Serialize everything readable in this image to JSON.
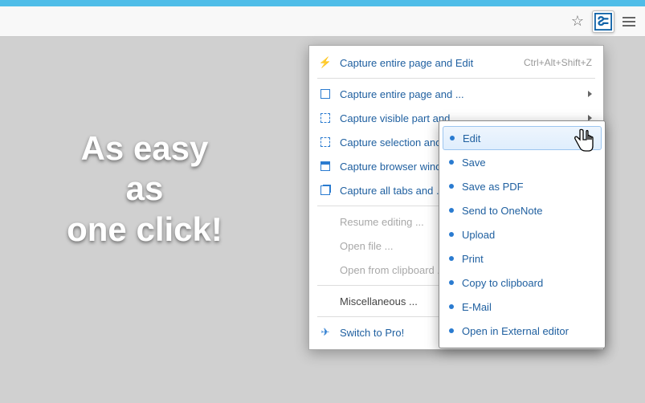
{
  "tagline": {
    "line1": "As easy",
    "line2": "as",
    "line3": "one click!"
  },
  "toolbar": {
    "star": "☆",
    "hamburger": "menu"
  },
  "menu": {
    "items": [
      {
        "label": "Capture entire page and Edit",
        "shortcut": "Ctrl+Alt+Shift+Z"
      },
      {
        "label": "Capture entire page and ..."
      },
      {
        "label": "Capture visible part and ..."
      },
      {
        "label": "Capture selection and ..."
      },
      {
        "label": "Capture browser window ..."
      },
      {
        "label": "Capture all tabs and ..."
      },
      {
        "label": "Resume editing ..."
      },
      {
        "label": "Open file ..."
      },
      {
        "label": "Open from clipboard ..."
      },
      {
        "label": "Miscellaneous ..."
      },
      {
        "label": "Switch to Pro!"
      }
    ]
  },
  "submenu": {
    "items": [
      {
        "label": "Edit"
      },
      {
        "label": "Save"
      },
      {
        "label": "Save as PDF"
      },
      {
        "label": "Send to OneNote"
      },
      {
        "label": "Upload"
      },
      {
        "label": "Print"
      },
      {
        "label": "Copy to clipboard"
      },
      {
        "label": "E-Mail"
      },
      {
        "label": "Open in External editor"
      }
    ]
  }
}
